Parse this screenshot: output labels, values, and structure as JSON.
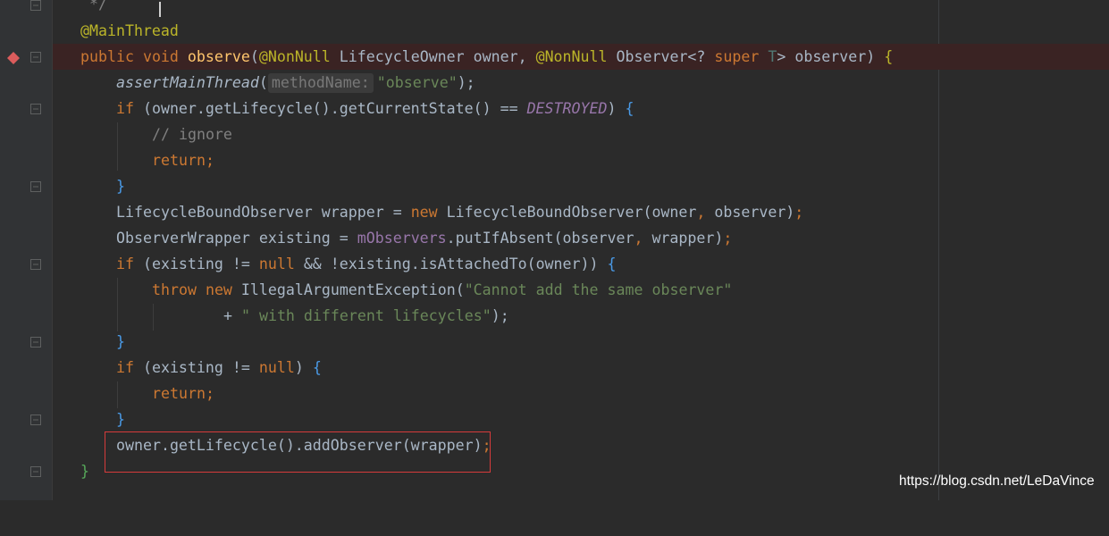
{
  "editor": {
    "lines": {
      "l0": {
        "c1": "*/"
      },
      "l1": {
        "c1": "@MainThread"
      },
      "l2": {
        "c1": "public",
        "c2": " ",
        "c3": "void",
        "c4": " ",
        "c5": "observe",
        "c6": "(",
        "c7": "@NonNull",
        "c8": " LifecycleOwner owner, ",
        "c9": "@NonNull",
        "c10": " Observer<? ",
        "c11": "super",
        "c12": " ",
        "c13": "T",
        "c14": "> observer) ",
        "c15": "{"
      },
      "l3": {
        "c1": "assertMainThread",
        "c2": "(",
        "hint": "methodName:",
        "c3": "\"observe\"",
        "c4": ");"
      },
      "l4": {
        "c1": "if",
        "c2": " (owner.getLifecycle().getCurrentState() == ",
        "c3": "DESTROYED",
        "c4": ") ",
        "c5": "{"
      },
      "l5": {
        "c1": "// ignore"
      },
      "l6": {
        "c1": "return;"
      },
      "l7": {
        "c1": "}"
      },
      "l8": {
        "c1": "LifecycleBoundObserver wrapper = ",
        "c2": "new",
        "c3": " LifecycleBoundObserver(owner",
        "c4": ",",
        "c5": " observer)",
        "c6": ";"
      },
      "l9": {
        "c1": "ObserverWrapper existing = ",
        "c2": "mObservers",
        "c3": ".putIfAbsent(observer",
        "c4": ",",
        "c5": " wrapper)",
        "c6": ";"
      },
      "l10": {
        "c1": "if",
        "c2": " (existing != ",
        "c3": "null",
        "c4": " && !existing.isAttachedTo(owner)) ",
        "c5": "{"
      },
      "l11": {
        "c1": "throw",
        "c2": " ",
        "c3": "new",
        "c4": " IllegalArgumentException(",
        "c5": "\"Cannot add the same observer\""
      },
      "l12": {
        "c1": "+ ",
        "c2": "\" with different lifecycles\"",
        "c3": ");"
      },
      "l13": {
        "c1": "}"
      },
      "l14": {
        "c1": "if",
        "c2": " (existing != ",
        "c3": "null",
        "c4": ") ",
        "c5": "{"
      },
      "l15": {
        "c1": "return;"
      },
      "l16": {
        "c1": "}"
      },
      "l17": {
        "c1": "owner.getLifecycle().addObserver(wrapper)",
        "c2": ";"
      },
      "l18": {
        "c1": "}"
      }
    }
  },
  "watermark": "https://blog.csdn.net/LeDaVince",
  "colors": {
    "background": "#2b2b2b",
    "keyword": "#cc7832",
    "annotation": "#bbb529",
    "method": "#ffc66d",
    "string": "#6a8759",
    "comment": "#808080",
    "constant": "#9876aa",
    "breakpoint": "#db5c5c",
    "highlight_box": "#d63b3b"
  },
  "icons": {
    "breakpoint": "breakpoint-icon",
    "fold": "fold-icon"
  }
}
